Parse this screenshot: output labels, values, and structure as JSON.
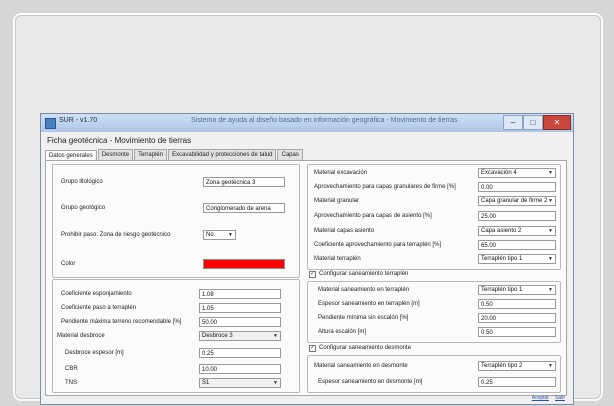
{
  "window": {
    "title": "SUR - v1.70",
    "subtitle": "Sistema de ayuda al diseño basado en información geográfica - Movimiento de tierras",
    "min": "–",
    "max": "□",
    "close": "✕",
    "heading": "Ficha geotécnica - Movimiento de tierras"
  },
  "tabs": [
    "Datos generales",
    "Desmonte",
    "Terraplén",
    "Excavabilidad y protecciones de talud",
    "Capas"
  ],
  "left_top": {
    "grupo_litologico_label": "Grupo litológico",
    "grupo_litologico_value": "Zona geotécnica 3",
    "grupo_geologico_label": "Grupo geológico",
    "grupo_geologico_value": "Conglomerado de arena",
    "proh_label": "Prohibir paso: Zona de riesgo geotécnico",
    "proh_value": "No",
    "color_label": "Color",
    "color_value": "#ff0000"
  },
  "left_bottom": {
    "coef_esponj_label": "Coeficiente esponjamiento",
    "coef_esponj_value": "1.08",
    "coef_paso_label": "Coeficiente paso a terraplén",
    "coef_paso_value": "1.05",
    "pendiente_label": "Pendiente máxima terreno recomendable [%]",
    "pendiente_value": "50.00",
    "material_desbroce_label": "Material desbroce",
    "material_desbroce_value": "Desbroce 3",
    "desbroce_espesor_label": "Desbroce espesor [m]",
    "desbroce_espesor_value": "0.25",
    "cbr_label": "CBR",
    "cbr_value": "10.00",
    "tns_label": "TNS",
    "tns_value": "S1"
  },
  "right_top": {
    "mat_excavacion_label": "Material excavación",
    "mat_excavacion_value": "Excavación 4",
    "aprov_granulares_label": "Aprovechamiento para capas granulares de firme [%]",
    "aprov_granulares_value": "0.00",
    "mat_granular_label": "Material granular",
    "mat_granular_value": "Capa granular de firme 2",
    "aprov_asiento_label": "Aprovechamiento para capas de asiento [%]",
    "aprov_asiento_value": "25.00",
    "mat_asiento_label": "Material capas asiento",
    "mat_asiento_value": "Capa asiento 2",
    "coef_terraplen_label": "Coeficiente aprovechamiento para terraplén [%]",
    "coef_terraplen_value": "65.00",
    "mat_terraplen_label": "Material terraplén",
    "mat_terraplen_value": "Terraplén tipo 1"
  },
  "right_mid": {
    "check_label": "Configurar saneamiento terraplén",
    "check_mark": "✓",
    "mat_saneamiento_label": "Material saneamiento en terraplén",
    "mat_saneamiento_value": "Terraplén tipo 1",
    "espesor_label": "Espesor saneamiento en terraplén [m]",
    "espesor_value": "0.50",
    "pendiente_label": "Pendiente mínima sin escalón [%]",
    "pendiente_value": "20.00",
    "altura_label": "Altura escalón [m]",
    "altura_value": "0.50"
  },
  "right_bottom": {
    "check_label": "Configurar saneamiento desmonte",
    "check_mark": "✓",
    "mat_label": "Material saneamiento en desmonte",
    "mat_value": "Terraplén tipo 2",
    "espesor_label": "Espesor saneamiento en desmonte [m]",
    "espesor_value": "0.25"
  },
  "footer": {
    "accept": "Aceptar",
    "cancel": "Salir"
  }
}
